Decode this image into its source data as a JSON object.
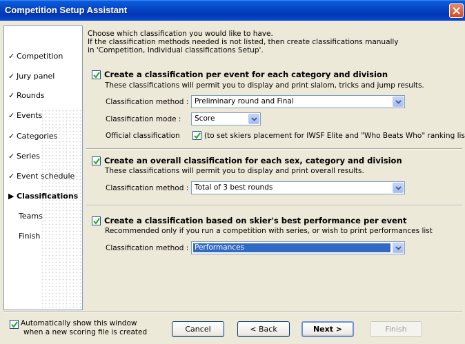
{
  "window": {
    "title": "Competition Setup Assistant"
  },
  "steps": [
    {
      "label": "Competition",
      "done": true
    },
    {
      "label": "Jury panel",
      "done": true
    },
    {
      "label": "Rounds",
      "done": true
    },
    {
      "label": "Events",
      "done": true
    },
    {
      "label": "Categories",
      "done": true
    },
    {
      "label": "Series",
      "done": true
    },
    {
      "label": "Event schedule",
      "done": true
    },
    {
      "label": "Classifications",
      "current": true
    },
    {
      "label": "Teams"
    },
    {
      "label": "Finish"
    }
  ],
  "intro": {
    "line1": "Choose which classification you would like to have.",
    "line2": "If the classification methods needed is not listed, then create classifications manually",
    "line3": "in 'Competition, Individual classifications Setup'."
  },
  "section1": {
    "checked": true,
    "title": "Create a classification per event for each category and division",
    "desc": "These classifications will permit you to display and print slalom, tricks and jump results.",
    "method_label": "Classification method :",
    "method_value": "Preliminary round and Final",
    "mode_label": "Classification mode :",
    "mode_value": "Score",
    "official_label": "Official classification",
    "official_checked": true,
    "official_desc": "(to set skiers placement for IWSF Elite and \"Who Beats Who\" ranking lists)"
  },
  "section2": {
    "checked": true,
    "title": "Create an overall classification for each sex, category and division",
    "desc": "These classifications will permit you to display and print overall results.",
    "method_label": "Classification method :",
    "method_value": "Total of 3 best rounds"
  },
  "section3": {
    "checked": true,
    "title": "Create a classification based on skier's best performance per event",
    "desc": "Recommended only if you run a competition with series, or wish to print performances list",
    "method_label": "Classification method :",
    "method_value": "Performances"
  },
  "footer": {
    "autoshow_checked": true,
    "autoshow_line1": "Automatically show this window",
    "autoshow_line2": "when a new scoring file is created",
    "cancel_label": "Cancel",
    "back_label": "< Back",
    "next_label": "Next >",
    "finish_label": "Finish"
  },
  "colors": {
    "titlebar": "#0a4ad0",
    "selection": "#316ac5",
    "dialog_bg": "#ece9d8"
  }
}
